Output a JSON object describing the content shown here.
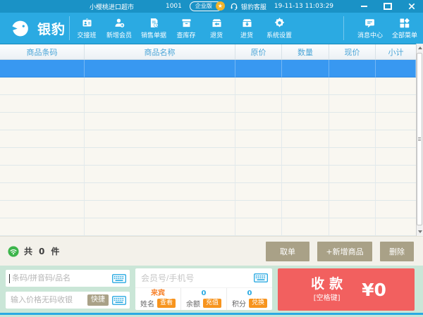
{
  "titlebar": {
    "store_name": "小樱桃进口超市",
    "store_id": "1001",
    "edition_badge": "企业版",
    "star": "★",
    "support_label": "银豹客服",
    "datetime": "19-11-13 11:03:29"
  },
  "toolbar": {
    "brand": "银豹",
    "items": [
      {
        "label": "交接班"
      },
      {
        "label": "新增会员"
      },
      {
        "label": "销售单据"
      },
      {
        "label": "查库存"
      },
      {
        "label": "退货"
      },
      {
        "label": "进货"
      },
      {
        "label": "系统设置"
      }
    ],
    "right_items": [
      {
        "label": "消息中心"
      },
      {
        "label": "全部菜单"
      }
    ]
  },
  "table": {
    "columns": [
      "商品条码",
      "商品名称",
      "原价",
      "数量",
      "现价",
      "小计"
    ],
    "empty_row_count": 10,
    "selected_row_index": 0,
    "rows": []
  },
  "statusbar": {
    "count_prefix": "共",
    "count": "0",
    "count_suffix": "件",
    "retrieve_order_label": "取单",
    "add_product_label": "+新增商品",
    "delete_label": "删除"
  },
  "checkout": {
    "barcode_input": {
      "placeholder": "条码/拼音码/品名",
      "value": ""
    },
    "price_input": {
      "placeholder": "输入价格无码收银",
      "value": "",
      "quick_label": "快捷"
    },
    "member_input": {
      "placeholder": "会员号/手机号",
      "value": ""
    },
    "member": {
      "name_value": "来宾",
      "name_label": "姓名",
      "view_button": "查看",
      "balance_value": "0",
      "balance_label": "余额",
      "recharge_button": "充值",
      "points_value": "0",
      "points_label": "积分",
      "redeem_button": "兑换"
    },
    "pay": {
      "label": "收款",
      "hint": "[空格键]",
      "amount": "¥0"
    }
  },
  "colors": {
    "titlebar_blue": "#1a92c6",
    "toolbar_blue": "#2baae2",
    "selected_row_blue": "#3898f1",
    "table_bg": "#f9f7f1",
    "khaki_button": "#a9a187",
    "pay_red": "#f2605f",
    "action_orange": "#f7941e",
    "panel_green": "#cae6d7",
    "online_green": "#3cb54b",
    "badge_gold": "#f0b42b"
  }
}
